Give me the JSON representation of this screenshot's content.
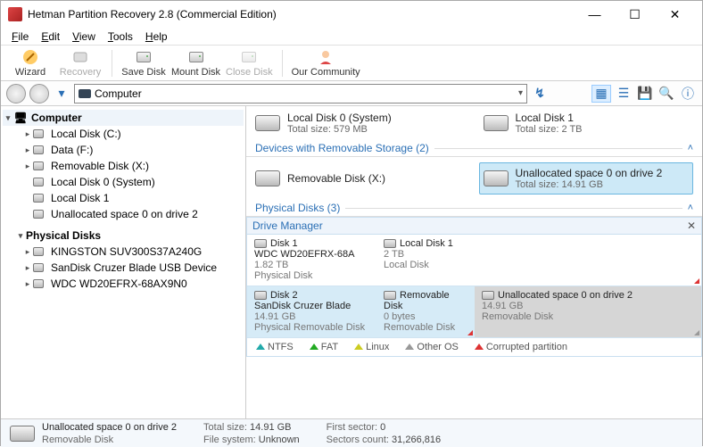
{
  "titlebar": {
    "title": "Hetman Partition Recovery 2.8 (Commercial Edition)"
  },
  "menu": {
    "file": "File",
    "edit": "Edit",
    "view": "View",
    "tools": "Tools",
    "help": "Help"
  },
  "toolbar": {
    "wizard": "Wizard",
    "recovery": "Recovery",
    "savedisk": "Save Disk",
    "mountdisk": "Mount Disk",
    "closedisk": "Close Disk",
    "community": "Our Community"
  },
  "address": {
    "label": "Computer"
  },
  "tree": {
    "root": "Computer",
    "items": [
      {
        "label": "Local Disk (C:)"
      },
      {
        "label": "Data (F:)"
      },
      {
        "label": "Removable Disk (X:)"
      },
      {
        "label": "Local Disk 0 (System)"
      },
      {
        "label": "Local Disk 1"
      },
      {
        "label": "Unallocated space 0 on drive 2"
      }
    ],
    "phys_header": "Physical Disks",
    "phys": [
      {
        "label": "KINGSTON SUV300S37A240G"
      },
      {
        "label": "SanDisk Cruzer Blade USB Device"
      },
      {
        "label": "WDC WD20EFRX-68AX9N0"
      }
    ]
  },
  "content": {
    "ld0": {
      "title": "Local Disk 0 (System)",
      "sub": "Total size: 579 MB"
    },
    "ld1": {
      "title": "Local Disk 1",
      "sub": "Total size: 2 TB"
    },
    "hdr_removable": "Devices with Removable Storage (2)",
    "rdx": {
      "title": "Removable Disk (X:)"
    },
    "unalloc": {
      "title": "Unallocated space 0 on drive 2",
      "sub": "Total size: 14.91 GB"
    },
    "hdr_phys": "Physical Disks (3)"
  },
  "dm": {
    "title": "Drive Manager",
    "rows": [
      {
        "disk": {
          "name": "Disk 1",
          "model": "WDC WD20EFRX-68A",
          "size": "1.82 TB",
          "type": "Physical Disk"
        },
        "parts": [
          {
            "name": "Local Disk 1",
            "size": "2 TB",
            "type": "Local Disk",
            "tri": "red"
          }
        ]
      },
      {
        "disk": {
          "name": "Disk 2",
          "model": "SanDisk Cruzer Blade",
          "size": "14.91 GB",
          "type": "Physical Removable Disk"
        },
        "parts": [
          {
            "name": "Removable Disk",
            "size": "0 bytes",
            "type": "Removable Disk",
            "tri": "red"
          },
          {
            "name": "Unallocated space 0 on drive 2",
            "size": "14.91 GB",
            "type": "Removable Disk",
            "tri": "gray",
            "gray": true
          }
        ]
      }
    ],
    "legend": {
      "ntfs": "NTFS",
      "fat": "FAT",
      "linux": "Linux",
      "other": "Other OS",
      "corrupt": "Corrupted partition"
    }
  },
  "status": {
    "title": "Unallocated space 0 on drive 2",
    "sub": "Removable Disk",
    "totalsize_k": "Total size:",
    "totalsize_v": "14.91 GB",
    "fs_k": "File system:",
    "fs_v": "Unknown",
    "first_k": "First sector:",
    "first_v": "0",
    "sectors_k": "Sectors count:",
    "sectors_v": "31,266,816"
  }
}
